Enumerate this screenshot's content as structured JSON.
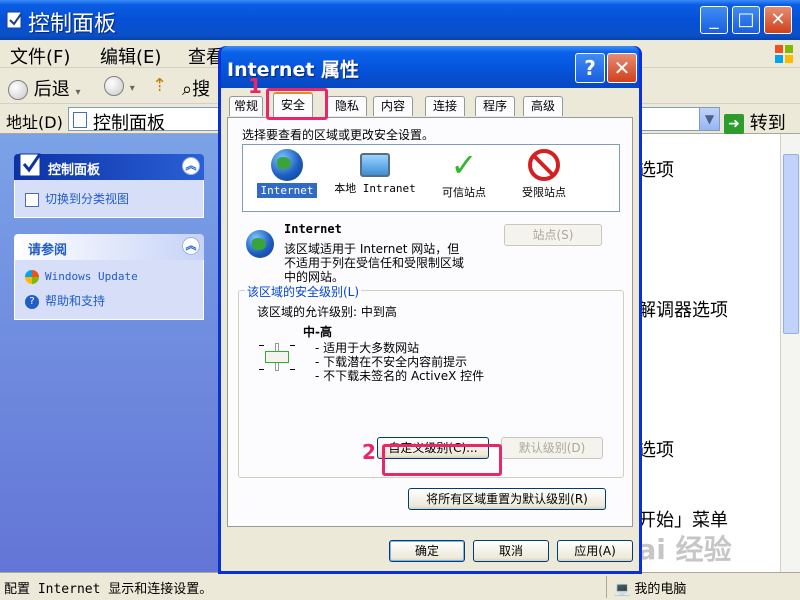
{
  "main_window": {
    "title": "控制面板",
    "menu": [
      "文件(F)",
      "编辑(E)",
      "查看"
    ],
    "toolbar": {
      "back_label": "后退",
      "search_partial": "搜"
    },
    "address": {
      "label": "地址(D)",
      "value": "控制面板",
      "go_label": "转到"
    },
    "task_pane": {
      "panel_title": "控制面板",
      "switch_view": "切换到分类视图",
      "see_also_title": "请参阅",
      "see_also_items": [
        "Windows Update",
        "帮助和支持"
      ]
    },
    "content_items": [
      "选项",
      "解调器选项",
      "选项",
      "开始」菜单"
    ],
    "status_text": "配置 Internet 显示和连接设置。",
    "status_zone": "我的电脑",
    "watermark": "Bai 经验"
  },
  "dialog": {
    "title": "Internet 属性",
    "tabs": [
      "常规",
      "安全",
      "隐私",
      "内容",
      "连接",
      "程序",
      "高级"
    ],
    "active_tab": "安全",
    "zone_prompt": "选择要查看的区域或更改安全设置。",
    "zones": [
      {
        "label": "Internet",
        "icon": "globe-icon",
        "selected": true
      },
      {
        "label": "本地 Intranet",
        "icon": "intranet-icon",
        "selected": false
      },
      {
        "label": "可信站点",
        "icon": "checkmark-icon",
        "selected": false
      },
      {
        "label": "受限站点",
        "icon": "restricted-icon",
        "selected": false
      }
    ],
    "zone_info_title": "Internet",
    "zone_info_lines": [
      "该区域适用于 Internet 网站，但",
      "不适用于列在受信任和受限制区域",
      "中的网站。"
    ],
    "sites_button": "站点(S)",
    "security_group_label": "该区域的安全级别(L)",
    "allowed_level": "该区域的允许级别: 中到高",
    "level_name": "中-高",
    "level_desc": [
      "- 适用于大多数网站",
      "- 下载潜在不安全内容前提示",
      "- 不下载未签名的 ActiveX 控件"
    ],
    "custom_level_button": "自定义级别(C)...",
    "default_level_button": "默认级别(D)",
    "reset_all_button": "将所有区域重置为默认级别(R)",
    "ok_button": "确定",
    "cancel_button": "取消",
    "apply_button": "应用(A)"
  },
  "annotations": {
    "step1": "1",
    "step2": "2"
  },
  "colors": {
    "highlight": "#e8276b",
    "xp_blue": "#0a5de3",
    "selection": "#316ac5"
  }
}
